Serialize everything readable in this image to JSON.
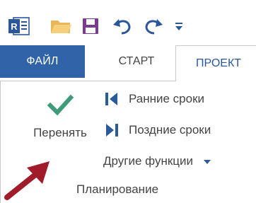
{
  "quick_access": {
    "icons": [
      "project-logo-icon",
      "open-folder-icon",
      "save-icon",
      "undo-icon",
      "redo-icon",
      "customize-qat-icon"
    ],
    "logo_text": "R",
    "customize_glyph": "="
  },
  "tabs": [
    {
      "label": "ФАЙЛ"
    },
    {
      "label": "СТАРТ"
    },
    {
      "label": "ПРОЕКТ"
    }
  ],
  "ribbon": {
    "accept_button": {
      "label": "Перенять"
    },
    "commands": [
      {
        "label": "Ранние сроки"
      },
      {
        "label": "Поздние сроки"
      },
      {
        "label": "Другие функции"
      }
    ],
    "group_label": "Планирование"
  },
  "colors": {
    "file_tab": "#3063a7",
    "active_tab_text": "#2b579a",
    "checkmark": "#3f9a78",
    "command_icon": "#2c5b9a",
    "annotation_arrow": "#a01c2a"
  }
}
